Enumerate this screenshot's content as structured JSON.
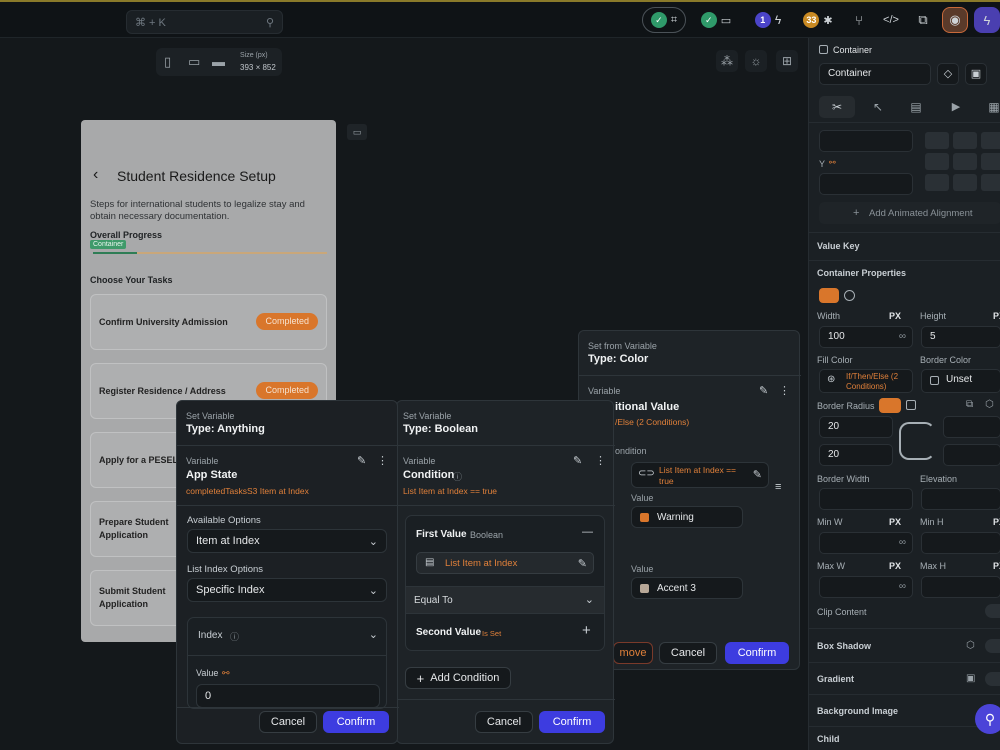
{
  "topbar": {
    "search_placeholder": "⌘ + K",
    "notif_count": "1",
    "warn_count": "33"
  },
  "device": {
    "size_label": "Size (px)",
    "size_value": "393 × 852"
  },
  "phone": {
    "title": "Student Residence Setup",
    "description": "Steps for international students to legalize stay and obtain necessary documentation.",
    "progress_label": "Overall Progress",
    "container_badge": "Container",
    "progress": 0.19,
    "choose_label": "Choose Your Tasks",
    "tasks": [
      {
        "label": "Confirm University Admission",
        "status": "Completed"
      },
      {
        "label": "Register Residence / Address",
        "status": "Completed"
      },
      {
        "label": "Apply for a PESEL",
        "status": ""
      },
      {
        "label": "Prepare Student Application",
        "status": ""
      },
      {
        "label": "Submit Student Application",
        "status": ""
      }
    ]
  },
  "panel_anything": {
    "header_sect": "Set Variable",
    "header_type": "Type: Anything",
    "var_sect": "Variable",
    "var_name": "App State",
    "var_path": "completedTasksS3 Item at Index",
    "available_label": "Available Options",
    "available_value": "Item at Index",
    "list_index_label": "List Index Options",
    "list_index_value": "Specific Index",
    "index_label": "Index",
    "value_label": "Value",
    "value_value": "0",
    "cancel": "Cancel",
    "confirm": "Confirm"
  },
  "panel_boolean": {
    "header_sect": "Set Variable",
    "header_type": "Type: Boolean",
    "var_sect": "Variable",
    "var_name": "Condition",
    "var_expr": "List Item at Index  ==  true",
    "first_value_label": "First Value",
    "first_value_type": "Boolean",
    "first_value_chip": "List Item at Index",
    "operator": "Equal To",
    "second_value_label": "Second Value",
    "second_value_set": "Is Set",
    "add_condition": "Add Condition",
    "cancel": "Cancel",
    "confirm": "Confirm"
  },
  "panel_color": {
    "header_sect": "Set from Variable",
    "header_type": "Type: Color",
    "var_sect": "Variable",
    "var_name": "itional Value",
    "var_expr": "/Else (2 Conditions)",
    "condition_label": "ondition",
    "cond_chip": "List Item at Index  ==  true",
    "value_label": "Value",
    "value1": "Warning",
    "value2": "Accent 3",
    "remove": "move",
    "cancel": "Cancel",
    "confirm": "Confirm",
    "warning_color": "#d9762b",
    "accent3_color": "#b8a898"
  },
  "right_panel": {
    "widget_check": "Container",
    "widget_name": "Container",
    "y_label": "Y",
    "add_animated": "Add Animated Alignment",
    "value_key": "Value Key",
    "container_props": "Container Properties",
    "width_label": "Width",
    "width_unit": "PX",
    "width_value": "100",
    "width_inf": "∞",
    "height_label": "Height",
    "height_unit": "PX",
    "height_value": "5",
    "fill_color_label": "Fill Color",
    "fill_color_value": "If/Then/Else (2 Conditions)",
    "border_color_label": "Border Color",
    "border_color_value": "Unset",
    "border_radius_label": "Border Radius",
    "radius_tl": "20",
    "radius_bl": "20",
    "border_width_label": "Border Width",
    "elevation_label": "Elevation",
    "min_w_label": "Min W",
    "min_h_label": "Min H",
    "max_w_label": "Max W",
    "max_h_label": "Max H",
    "unit_px": "PX",
    "inf": "∞",
    "clip_content": "Clip Content",
    "box_shadow": "Box Shadow",
    "gradient": "Gradient",
    "background_image": "Background Image",
    "child": "Child"
  }
}
